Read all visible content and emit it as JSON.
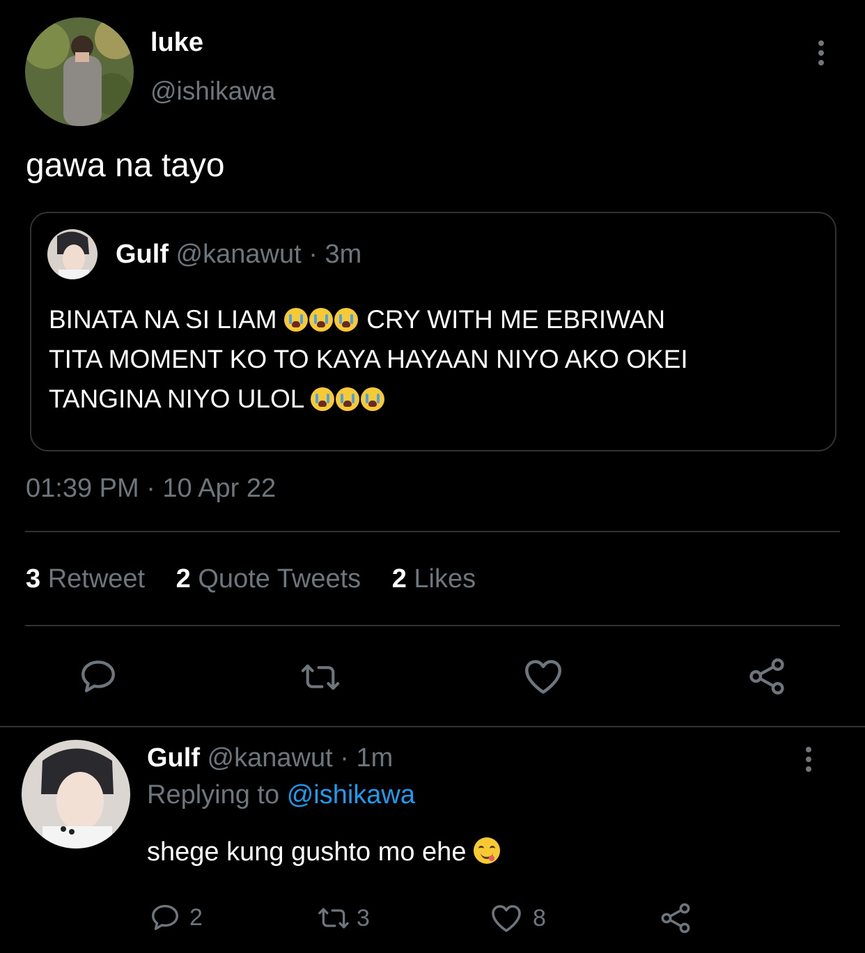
{
  "main_tweet": {
    "author_name": "luke",
    "author_handle": "@ishikawa",
    "text": "gawa na tayo",
    "quoted": {
      "author_name": "Gulf",
      "author_handle": "@kanawut",
      "separator": "·",
      "time": "3m",
      "line1": "BINATA NA SI LIAM",
      "line1b": "CRY WITH ME EBRIWAN",
      "line2": "TITA MOMENT KO TO KAYA HAYAAN NIYO AKO OKEI",
      "line3": "TANGINA NIYO ULOL"
    },
    "timestamp": "01:39 PM · 10 Apr 22",
    "stats": {
      "retweets_count": "3",
      "retweets_label": "Retweet",
      "quotes_count": "2",
      "quotes_label": "Quote Tweets",
      "likes_count": "2",
      "likes_label": "Likes"
    }
  },
  "reply": {
    "author_name": "Gulf",
    "author_handle": "@kanawut",
    "separator": "·",
    "time": "1m",
    "replying_label": "Replying to",
    "replying_handle": "@ishikawa",
    "text": "shege kung gushto mo ehe",
    "reply_count": "2",
    "retweet_count": "3",
    "like_count": "8"
  },
  "icons": {
    "reply": "reply-icon",
    "retweet": "retweet-icon",
    "like": "heart-icon",
    "share": "share-icon",
    "more": "more-icon",
    "emoji_crying": "loudly-crying-face-emoji",
    "emoji_yum": "face-savoring-food-emoji"
  },
  "colors": {
    "background": "#000000",
    "muted": "#6e767d",
    "link": "#1d9bf0",
    "divider": "#2f3336"
  }
}
